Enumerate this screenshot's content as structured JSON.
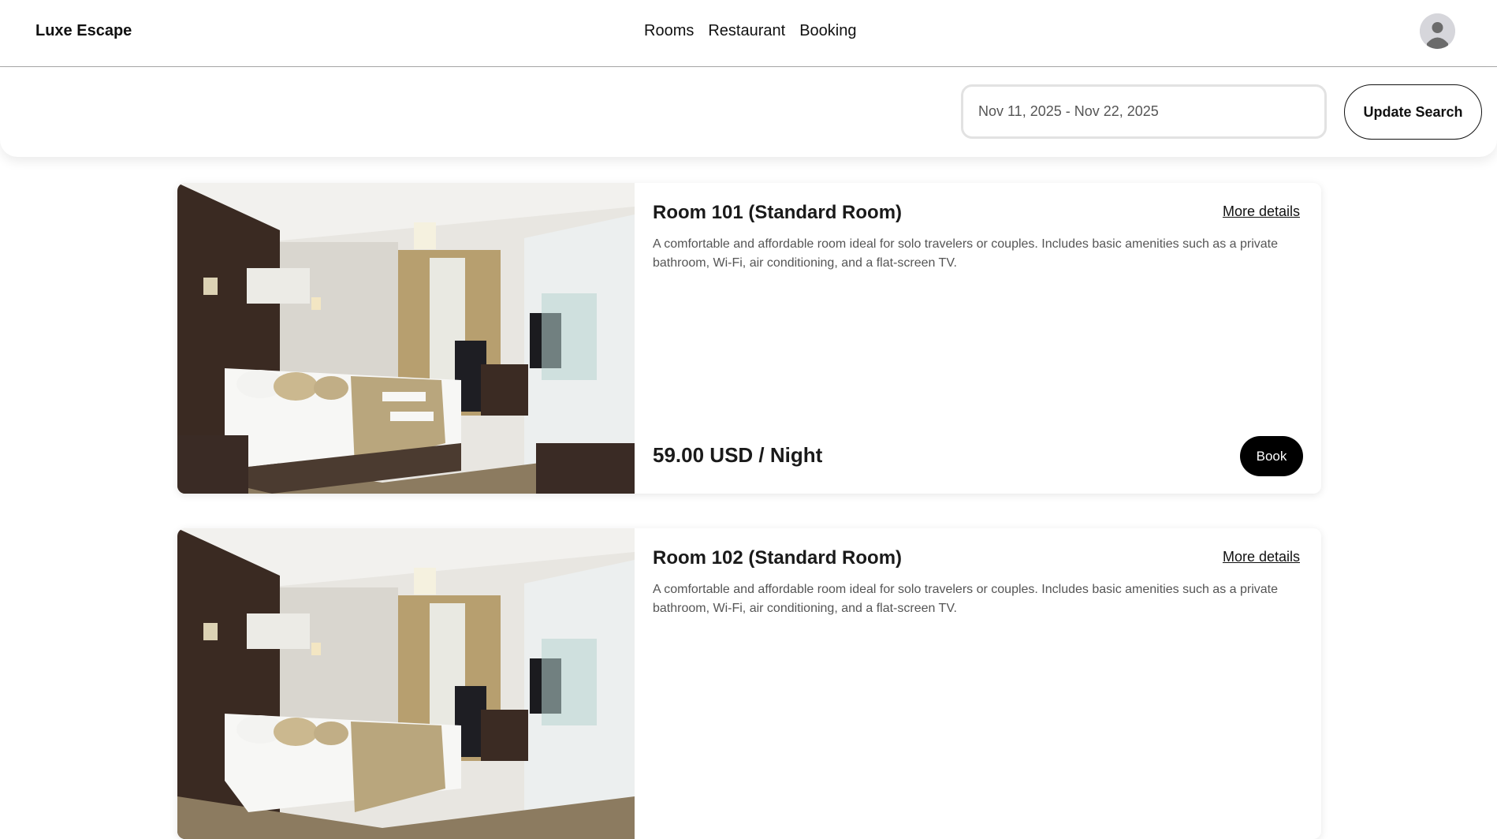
{
  "header": {
    "brand": "Luxe Escape",
    "nav": [
      "Rooms",
      "Restaurant",
      "Booking"
    ],
    "avatar_icon": "user-avatar-icon"
  },
  "search": {
    "date_range_value": "Nov 11, 2025 - Nov 22, 2025",
    "update_button_label": "Update Search"
  },
  "rooms": [
    {
      "title": "Room 101 (Standard Room)",
      "more_details_label": "More details",
      "description": "A comfortable and affordable room ideal for solo travelers or couples. Includes basic amenities such as a private bathroom, Wi-Fi, air conditioning, and a flat-screen TV.",
      "price": "59.00 USD / Night",
      "book_label": "Book"
    },
    {
      "title": "Room 102 (Standard Room)",
      "more_details_label": "More details",
      "description": "A comfortable and affordable room ideal for solo travelers or couples. Includes basic amenities such as a private bathroom, Wi-Fi, air conditioning, and a flat-screen TV.",
      "price": "",
      "book_label": ""
    }
  ],
  "colors": {
    "accent": "#000000",
    "background": "#ffffff",
    "text_muted": "#555555",
    "border": "#e2e2e2"
  }
}
